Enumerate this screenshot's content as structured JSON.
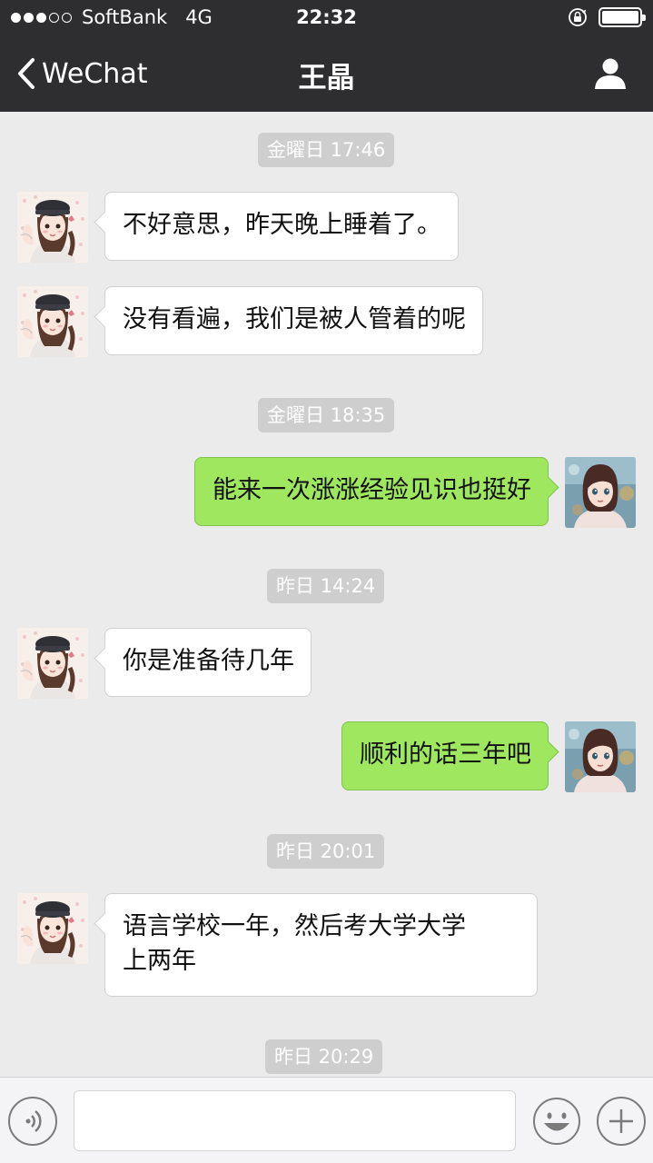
{
  "status_bar": {
    "signal_full": 3,
    "signal_total": 5,
    "carrier": "SoftBank",
    "network": "4G",
    "time": "22:32",
    "battery_level": 1.0
  },
  "nav": {
    "back_label": "WeChat",
    "title": "王晶",
    "icons": {
      "back": "chevron-left-icon",
      "profile": "person-icon"
    }
  },
  "chat": {
    "timestamps": [
      "金曜日 17:46",
      "金曜日 18:35",
      "昨日 14:24",
      "昨日 20:01",
      "昨日 20:29"
    ],
    "messages": [
      {
        "sender": "contact",
        "text": "不好意思，昨天晚上睡着了。"
      },
      {
        "sender": "contact",
        "text": "没有看遍，我们是被人管着的呢"
      },
      {
        "sender": "me",
        "text": "能来一次涨涨经验见识也挺好"
      },
      {
        "sender": "contact",
        "text": "你是准备待几年"
      },
      {
        "sender": "me",
        "text": "顺利的话三年吧"
      },
      {
        "sender": "contact",
        "text": "语言学校一年，然后考大学大学\n上两年"
      }
    ]
  },
  "input_bar": {
    "text_value": "",
    "icons": {
      "voice": "voice-icon",
      "emoji": "emoji-icon",
      "more": "plus-icon"
    }
  },
  "colors": {
    "bar_bg": "#2e2e31",
    "chat_bg": "#ebebeb",
    "out_bubble": "#9fe75e",
    "in_bubble": "#ffffff",
    "timestamp_bg": "#cecece"
  }
}
